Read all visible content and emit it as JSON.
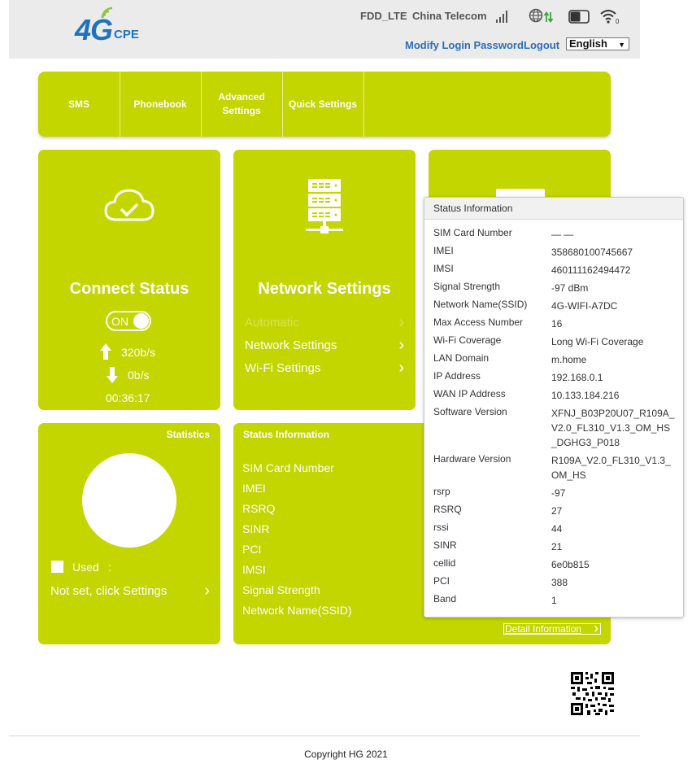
{
  "header": {
    "logo_big": "4G",
    "logo_small": "CPE",
    "network_type": "FDD_LTE",
    "operator": "China Telecom",
    "modify_password": "Modify Login Password",
    "logout": "Logout",
    "language": "English"
  },
  "menu": [
    {
      "label": "SMS"
    },
    {
      "label": "Phonebook"
    },
    {
      "label": "Advanced Settings"
    },
    {
      "label": "Quick Settings"
    }
  ],
  "connect": {
    "title": "Connect Status",
    "toggle": "ON",
    "upload": "320b/s",
    "download": "0b/s",
    "duration": "00:36:17"
  },
  "network": {
    "title": "Network Settings",
    "mode": "Automatic",
    "link1": "Network Settings",
    "link2": "Wi-Fi Settings"
  },
  "statistics": {
    "title": "Statistics",
    "used": "Used",
    "used_sep": ":",
    "not_set": "Not set, click Settings"
  },
  "status_card": {
    "title": "Status Information",
    "labels": [
      "SIM Card Number",
      "IMEI",
      "RSRQ",
      "SINR",
      "PCI",
      "IMSI",
      "Signal Strength",
      "Network Name(SSID)"
    ],
    "detail_link": "Detail Information"
  },
  "popup": {
    "title": "Status Information",
    "rows": [
      {
        "label": "SIM Card Number",
        "value": "— —"
      },
      {
        "label": "IMEI",
        "value": "358680100745667"
      },
      {
        "label": "IMSI",
        "value": "460111162494472"
      },
      {
        "label": "Signal Strength",
        "value": "-97 dBm"
      },
      {
        "label": "Network Name(SSID)",
        "value": "4G-WIFI-A7DC"
      },
      {
        "label": "Max Access Number",
        "value": "16"
      },
      {
        "label": "Wi-Fi Coverage",
        "value": "Long Wi-Fi Coverage"
      },
      {
        "label": "LAN Domain",
        "value": "m.home"
      },
      {
        "label": "IP Address",
        "value": "192.168.0.1"
      },
      {
        "label": "WAN IP Address",
        "value": "10.133.184.216"
      },
      {
        "label": "Software Version",
        "value": "XFNJ_B03P20U07_R109A_V2.0_FL310_V1.3_OM_HS_DGHG3_P018"
      },
      {
        "label": "Hardware Version",
        "value": "R109A_V2.0_FL310_V1.3_OM_HS"
      },
      {
        "label": "rsrp",
        "value": "-97"
      },
      {
        "label": "RSRQ",
        "value": "27"
      },
      {
        "label": "rssi",
        "value": "44"
      },
      {
        "label": "SINR",
        "value": "21"
      },
      {
        "label": "cellid",
        "value": "6e0b815"
      },
      {
        "label": "PCI",
        "value": "388"
      },
      {
        "label": "Band",
        "value": "1"
      }
    ]
  },
  "footer": {
    "copyright": "Copyright HG 2021"
  },
  "icons": {
    "signal": "signal-bars-icon",
    "internet": "globe-icon",
    "battery": "battery-icon",
    "wifi": "wifi-icon",
    "cloud": "cloud-check-icon",
    "server": "server-icon",
    "qr": "qr-code-icon"
  },
  "colors": {
    "accent": "#c3d600",
    "link": "#2a6ebb",
    "logo": "#1e73be",
    "header_bg": "#ebebeb"
  }
}
